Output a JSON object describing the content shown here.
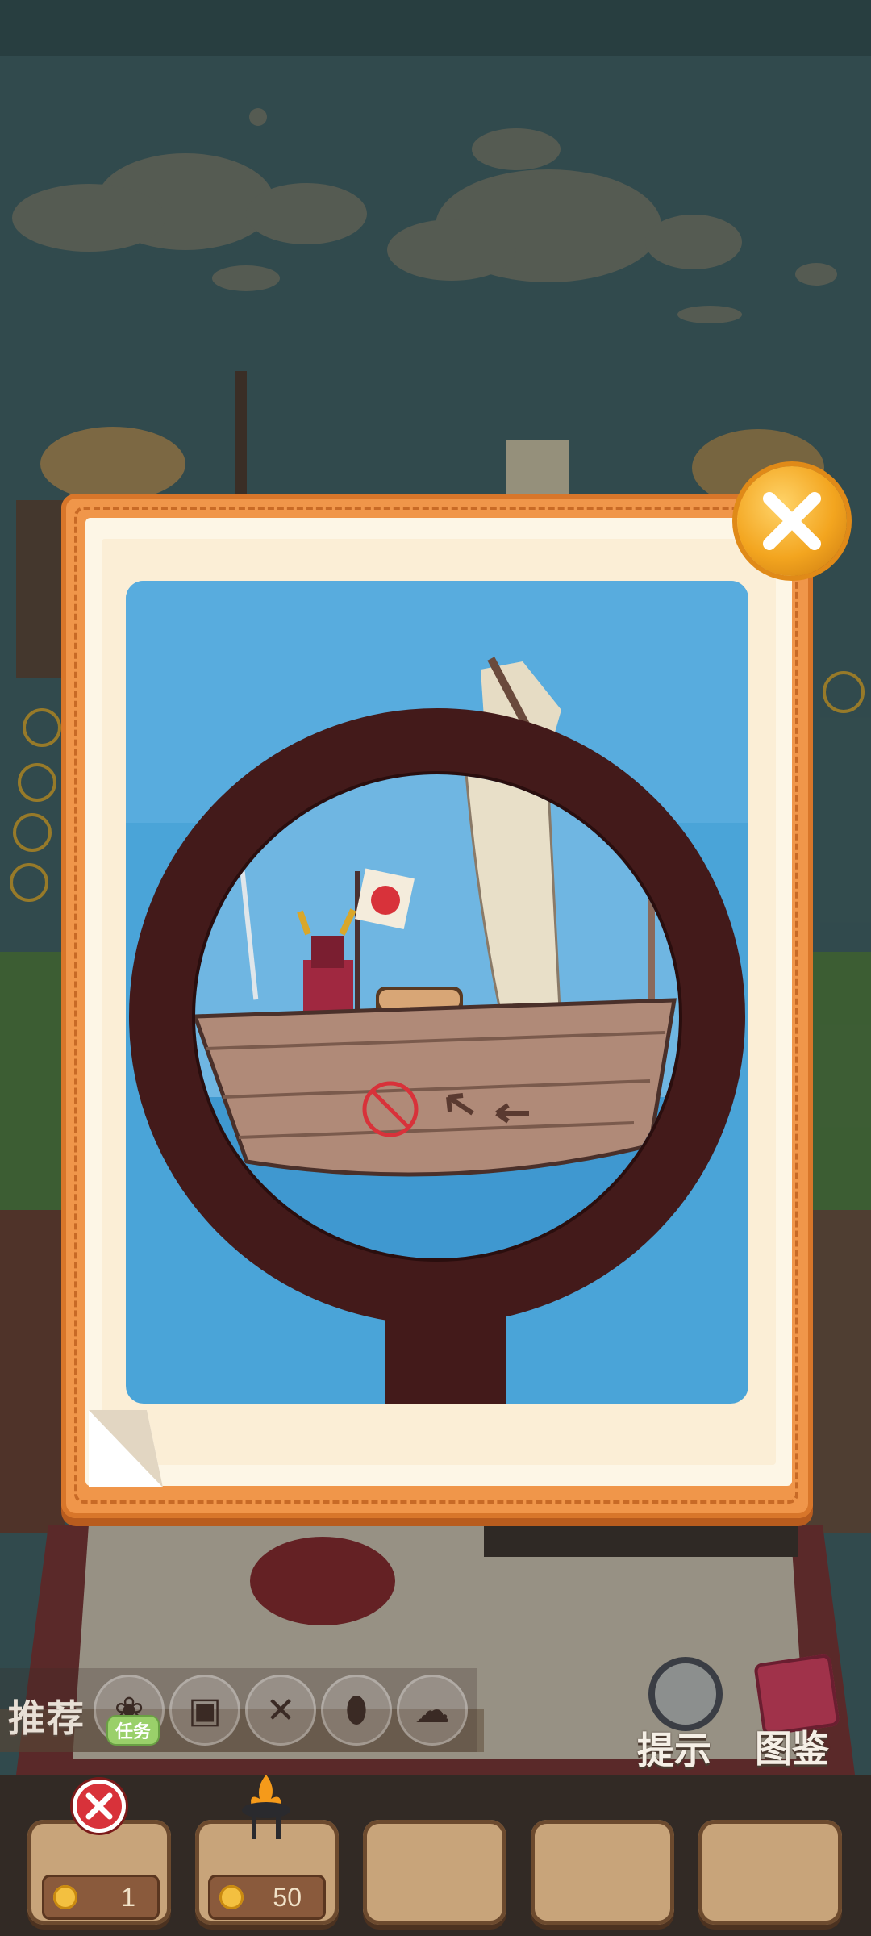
{
  "hud": {
    "recommend_label": "推荐",
    "recommend_badge": "任务",
    "hint_label": "提示",
    "atlas_label": "图鉴",
    "slots": [
      {
        "coin_value": "1"
      },
      {
        "coin_value": "50"
      },
      {},
      {},
      {}
    ]
  },
  "icons": {
    "close": "close-icon",
    "hint": "magnifier-icon",
    "atlas": "book-icon",
    "coin": "coin-icon",
    "forbidden": "no-entry-icon"
  },
  "colors": {
    "modal_frame": "#f0964a",
    "paper": "#fdf6e6",
    "scene_water": "#4aa4d8",
    "magnifier": "#431a1a",
    "close_button": "#f3a51f"
  }
}
